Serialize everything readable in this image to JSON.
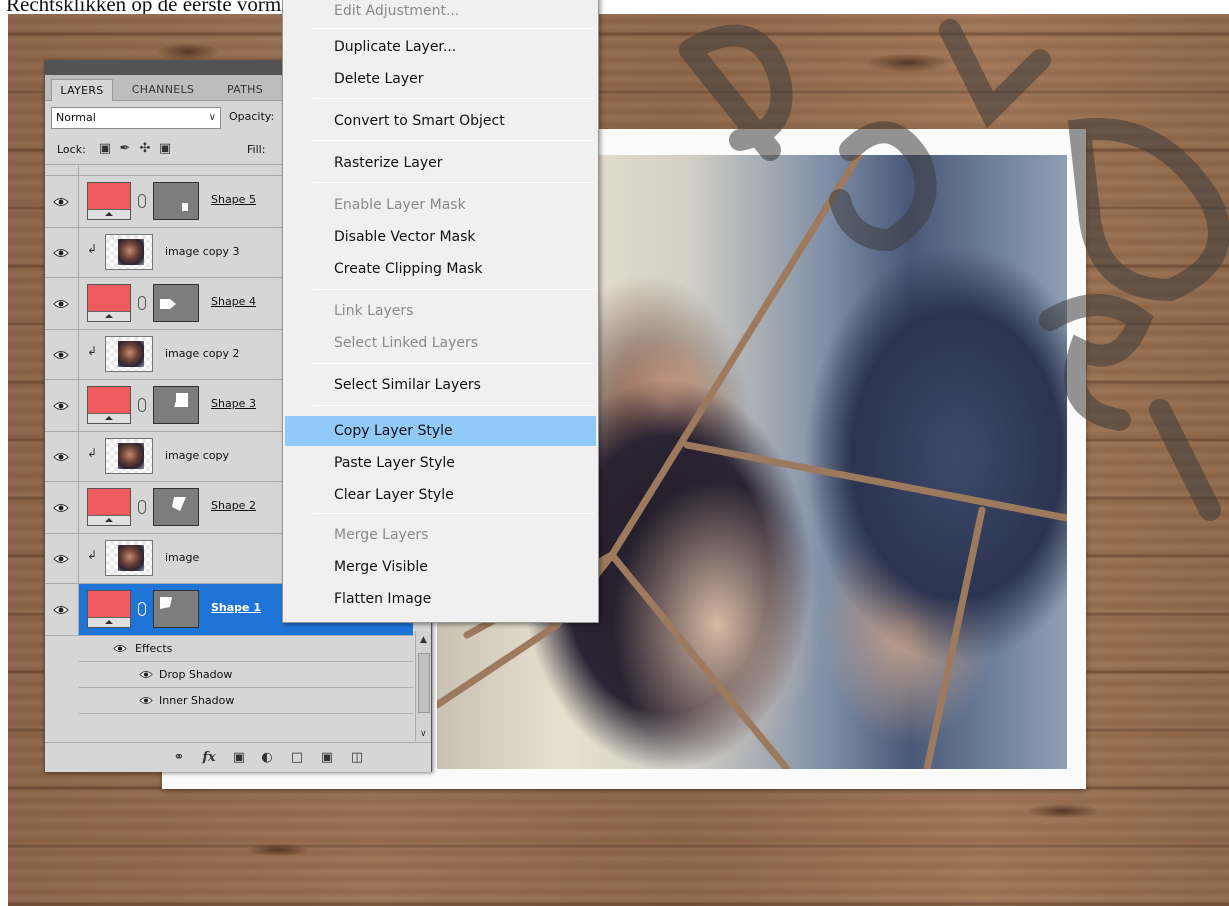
{
  "caption": "Rechtsklikken op de eerste vorm laag → Kies voor Laagstijl kopiëren.",
  "panel": {
    "tabs": [
      "LAYERS",
      "CHANNELS",
      "PATHS"
    ],
    "blend_mode": "Normal",
    "opacity_label": "Opacity:",
    "lock_label": "Lock:",
    "fill_label": "Fill:",
    "layers": [
      {
        "name": "Shape 5",
        "kind": "shape"
      },
      {
        "name": "image copy 3",
        "kind": "image"
      },
      {
        "name": "Shape 4",
        "kind": "shape"
      },
      {
        "name": "image copy 2",
        "kind": "image"
      },
      {
        "name": "Shape 3",
        "kind": "shape"
      },
      {
        "name": "image copy",
        "kind": "image"
      },
      {
        "name": "Shape 2",
        "kind": "shape"
      },
      {
        "name": "image",
        "kind": "image"
      },
      {
        "name": "Shape 1",
        "kind": "shape",
        "selected": true
      }
    ],
    "effects": {
      "label": "Effects",
      "items": [
        "Drop Shadow",
        "Inner Shadow"
      ]
    },
    "swatch_color": "#f05a5f",
    "selected_color": "#1f74d8"
  },
  "menu": {
    "items": [
      {
        "label": "Edit Adjustment...",
        "disabled": true
      },
      {
        "label": "Duplicate Layer..."
      },
      {
        "label": "Delete Layer"
      },
      {
        "label": "Convert to Smart Object"
      },
      {
        "label": "Rasterize Layer"
      },
      {
        "label": "Enable Layer Mask",
        "disabled": true
      },
      {
        "label": "Disable Vector Mask"
      },
      {
        "label": "Create Clipping Mask"
      },
      {
        "label": "Link Layers",
        "disabled": true
      },
      {
        "label": "Select Linked Layers",
        "disabled": true
      },
      {
        "label": "Select Similar Layers"
      },
      {
        "label": "Copy Layer Style",
        "highlighted": true
      },
      {
        "label": "Paste Layer Style"
      },
      {
        "label": "Clear Layer Style"
      },
      {
        "label": "Merge Layers",
        "disabled": true
      },
      {
        "label": "Merge Visible"
      },
      {
        "label": "Flatten Image"
      }
    ],
    "highlight_color": "#91c9f7"
  },
  "icons": {
    "visibility": "eye-icon",
    "link": "chain-link-icon",
    "fx": "fx-icon",
    "bottom_bar": [
      "link-layers-icon",
      "add-style-icon",
      "add-mask-icon",
      "adjustment-layer-icon",
      "new-group-icon",
      "new-layer-icon",
      "trash-icon"
    ]
  }
}
